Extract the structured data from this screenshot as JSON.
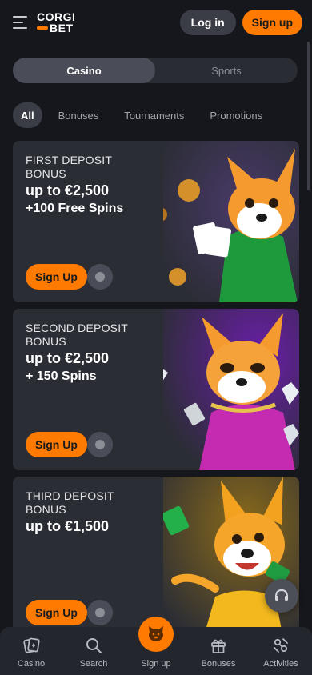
{
  "header": {
    "logo_top": "CORGI",
    "logo_bottom": "BET",
    "login_label": "Log in",
    "signup_label": "Sign up"
  },
  "segmented": {
    "items": [
      {
        "label": "Casino",
        "active": true
      },
      {
        "label": "Sports",
        "active": false
      }
    ]
  },
  "filters": {
    "items": [
      {
        "label": "All",
        "active": true
      },
      {
        "label": "Bonuses"
      },
      {
        "label": "Tournaments"
      },
      {
        "label": "Promotions"
      }
    ]
  },
  "promos": [
    {
      "title": "FIRST DEPOSIT BONUS",
      "amount": "up to €2,500",
      "extra": "+100 Free Spins",
      "cta": "Sign Up",
      "accent": "#1e7a3c"
    },
    {
      "title": "SECOND DEPOSIT BONUS",
      "amount": "up to €2,500",
      "extra": "+ 150 Spins",
      "cta": "Sign Up",
      "accent": "#6a1ea8"
    },
    {
      "title": "THIRD DEPOSIT BONUS",
      "amount": "up to €1,500",
      "extra": "",
      "cta": "Sign Up",
      "accent": "#b88410"
    }
  ],
  "bottom_nav": {
    "items": [
      {
        "label": "Casino",
        "icon": "cards-icon"
      },
      {
        "label": "Search",
        "icon": "search-icon"
      },
      {
        "label": "Sign up",
        "icon": "corgi-icon"
      },
      {
        "label": "Bonuses",
        "icon": "gift-icon"
      },
      {
        "label": "Activities",
        "icon": "activities-icon"
      }
    ]
  },
  "colors": {
    "accent": "#ff7a00",
    "background": "#16171d",
    "card": "#2b2d35"
  }
}
